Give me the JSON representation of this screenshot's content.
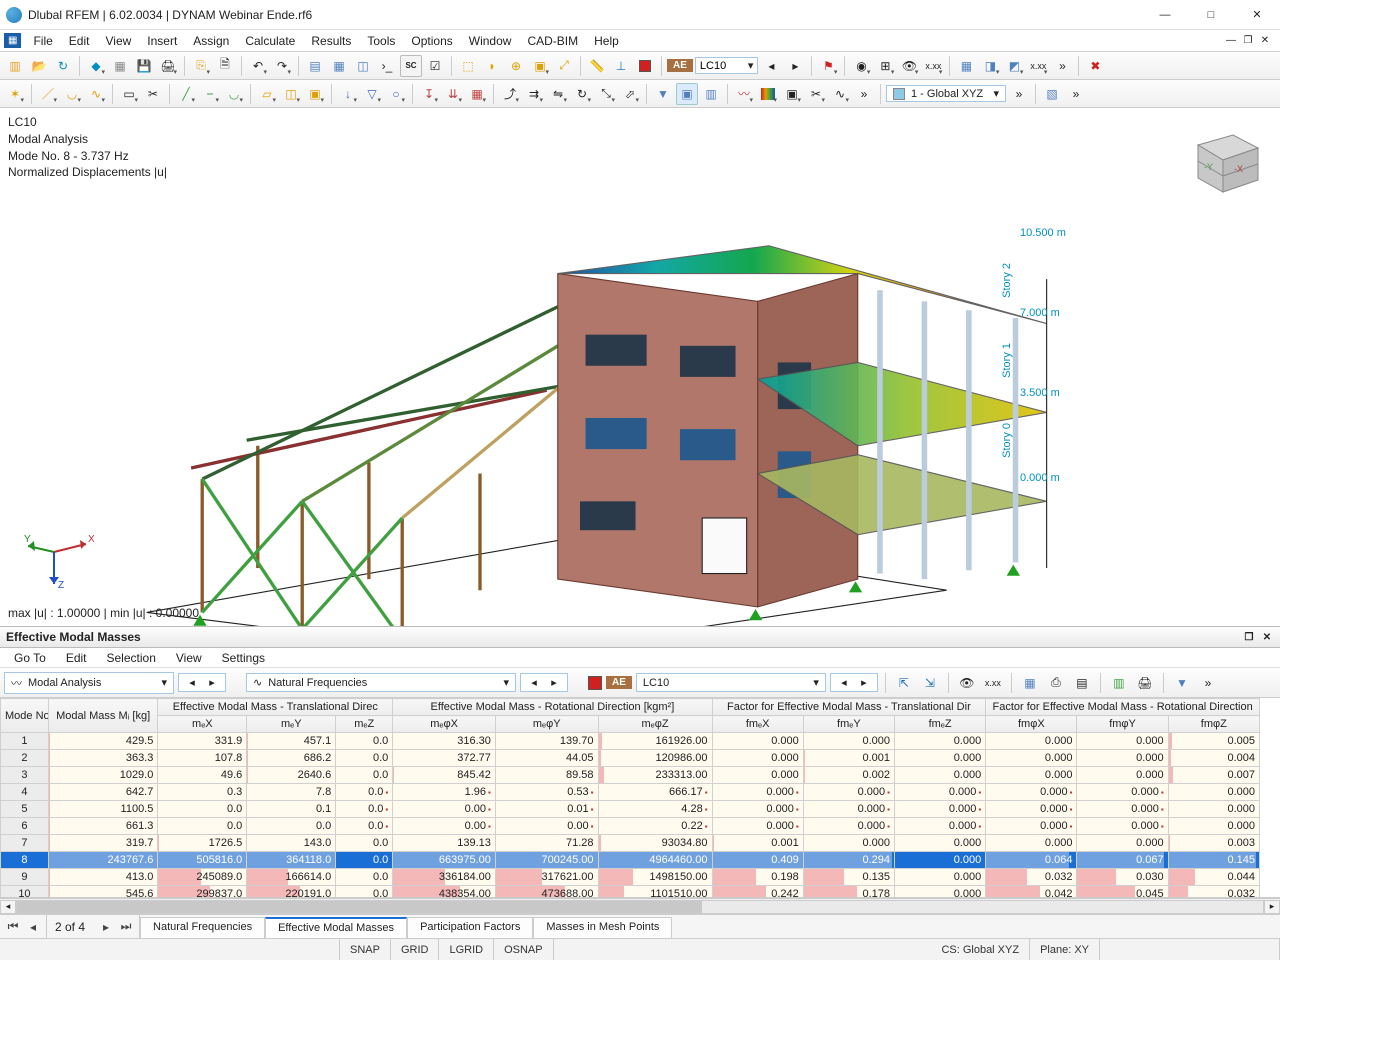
{
  "window": {
    "title": "Dlubal RFEM | 6.02.0034 | DYNAM Webinar Ende.rf6",
    "min": "—",
    "max": "□",
    "close": "✕",
    "inner_min": "—",
    "inner_restore": "❐",
    "inner_close": "✕"
  },
  "menu": {
    "items": [
      "File",
      "Edit",
      "View",
      "Insert",
      "Assign",
      "Calculate",
      "Results",
      "Tools",
      "Options",
      "Window",
      "CAD-BIM",
      "Help"
    ]
  },
  "toolbar1": {
    "sc_label": "SC",
    "ae_label": "AE",
    "lc_value": "LC10",
    "cs_value": "1 - Global XYZ"
  },
  "viewport": {
    "lines": [
      "LC10",
      "Modal Analysis",
      "Mode No. 8 - 3.737 Hz",
      "Normalized Displacements |u|"
    ],
    "bottom": "max |u| : 1.00000 | min |u| : 0.00000",
    "levels": [
      {
        "h": "10.500 m",
        "story": "Story 2"
      },
      {
        "h": "7.000 m",
        "story": "Story 1"
      },
      {
        "h": "3.500 m",
        "story": "Story 0"
      },
      {
        "h": "0.000 m",
        "story": ""
      }
    ],
    "axes": {
      "x": "X",
      "y": "Y",
      "z": "Z"
    },
    "cube": {
      "x": "-X",
      "y": "-Y"
    }
  },
  "panel": {
    "title": "Effective Modal Masses",
    "menu": [
      "Go To",
      "Edit",
      "Selection",
      "View",
      "Settings"
    ],
    "sel1": "Modal Analysis",
    "sel2": "Natural Frequencies",
    "ae_label": "AE",
    "lc_value": "LC10"
  },
  "table": {
    "group_headers": [
      "Mode No.",
      "Modal Mass Mᵢ [kg]",
      "Effective Modal Mass - Translational Direc",
      "Effective Modal Mass - Rotational Direction [kgm²]",
      "Factor for Effective Modal Mass - Translational Dir",
      "Factor for Effective Modal Mass - Rotational Direction"
    ],
    "sub_headers": [
      "",
      "",
      "mₑX",
      "mₑY",
      "mₑZ",
      "mₑφX",
      "mₑφY",
      "mₑφZ",
      "fmₑX",
      "fmₑY",
      "fmₑZ",
      "fmφX",
      "fmφY",
      "fmφZ"
    ],
    "rows": [
      {
        "n": "1",
        "mm": "429.5",
        "mx": "331.9",
        "my": "457.1",
        "mz": "0.0",
        "rx": "316.30",
        "ry": "139.70",
        "rz": "161926.00",
        "fx": "0.000",
        "fy": "0.000",
        "fz": "0.000",
        "frx": "0.000",
        "fry": "0.000",
        "frz": "0.005"
      },
      {
        "n": "2",
        "mm": "363.3",
        "mx": "107.8",
        "my": "686.2",
        "mz": "0.0",
        "rx": "372.77",
        "ry": "44.05",
        "rz": "120986.00",
        "fx": "0.000",
        "fy": "0.001",
        "fz": "0.000",
        "frx": "0.000",
        "fry": "0.000",
        "frz": "0.004"
      },
      {
        "n": "3",
        "mm": "1029.0",
        "mx": "49.6",
        "my": "2640.6",
        "mz": "0.0",
        "rx": "845.42",
        "ry": "89.58",
        "rz": "233313.00",
        "fx": "0.000",
        "fy": "0.002",
        "fz": "0.000",
        "frx": "0.000",
        "fry": "0.000",
        "frz": "0.007"
      },
      {
        "n": "4",
        "mm": "642.7",
        "mx": "0.3",
        "my": "7.8",
        "mz": "0.0",
        "rx": "1.96",
        "ry": "0.53",
        "rz": "666.17",
        "fx": "0.000",
        "fy": "0.000",
        "fz": "0.000",
        "frx": "0.000",
        "fry": "0.000",
        "frz": "0.000",
        "flag": true
      },
      {
        "n": "5",
        "mm": "1100.5",
        "mx": "0.0",
        "my": "0.1",
        "mz": "0.0",
        "rx": "0.00",
        "ry": "0.01",
        "rz": "4.28",
        "fx": "0.000",
        "fy": "0.000",
        "fz": "0.000",
        "frx": "0.000",
        "fry": "0.000",
        "frz": "0.000",
        "flag": true
      },
      {
        "n": "6",
        "mm": "661.3",
        "mx": "0.0",
        "my": "0.0",
        "mz": "0.0",
        "rx": "0.00",
        "ry": "0.00",
        "rz": "0.22",
        "fx": "0.000",
        "fy": "0.000",
        "fz": "0.000",
        "frx": "0.000",
        "fry": "0.000",
        "frz": "0.000",
        "flag": true
      },
      {
        "n": "7",
        "mm": "319.7",
        "mx": "1726.5",
        "my": "143.0",
        "mz": "0.0",
        "rx": "139.13",
        "ry": "71.28",
        "rz": "93034.80",
        "fx": "0.001",
        "fy": "0.000",
        "fz": "0.000",
        "frx": "0.000",
        "fry": "0.000",
        "frz": "0.003"
      },
      {
        "n": "8",
        "mm": "243767.6",
        "mx": "505816.0",
        "my": "364118.0",
        "mz": "0.0",
        "rx": "663975.00",
        "ry": "700245.00",
        "rz": "4964460.00",
        "fx": "0.409",
        "fy": "0.294",
        "fz": "0.000",
        "frx": "0.064",
        "fry": "0.067",
        "frz": "0.145",
        "sel": true
      },
      {
        "n": "9",
        "mm": "413.0",
        "mx": "245089.0",
        "my": "166614.0",
        "mz": "0.0",
        "rx": "336184.00",
        "ry": "317621.00",
        "rz": "1498150.00",
        "fx": "0.198",
        "fy": "0.135",
        "fz": "0.000",
        "frx": "0.032",
        "fry": "0.030",
        "frz": "0.044"
      },
      {
        "n": "10",
        "mm": "545.6",
        "mx": "299837.0",
        "my": "220191.0",
        "mz": "0.0",
        "rx": "438354.00",
        "ry": "473688.00",
        "rz": "1101510.00",
        "fx": "0.242",
        "fy": "0.178",
        "fz": "0.000",
        "frx": "0.042",
        "fry": "0.045",
        "frz": "0.032"
      }
    ]
  },
  "tabs": {
    "page": "2 of 4",
    "items": [
      "Natural Frequencies",
      "Effective Modal Masses",
      "Participation Factors",
      "Masses in Mesh Points"
    ],
    "active": 1
  },
  "status": {
    "snap": "SNAP",
    "grid": "GRID",
    "lgrid": "LGRID",
    "osnap": "OSNAP",
    "cs": "CS: Global XYZ",
    "plane": "Plane: XY"
  },
  "colors": {
    "accent": "#1a6fd6"
  }
}
